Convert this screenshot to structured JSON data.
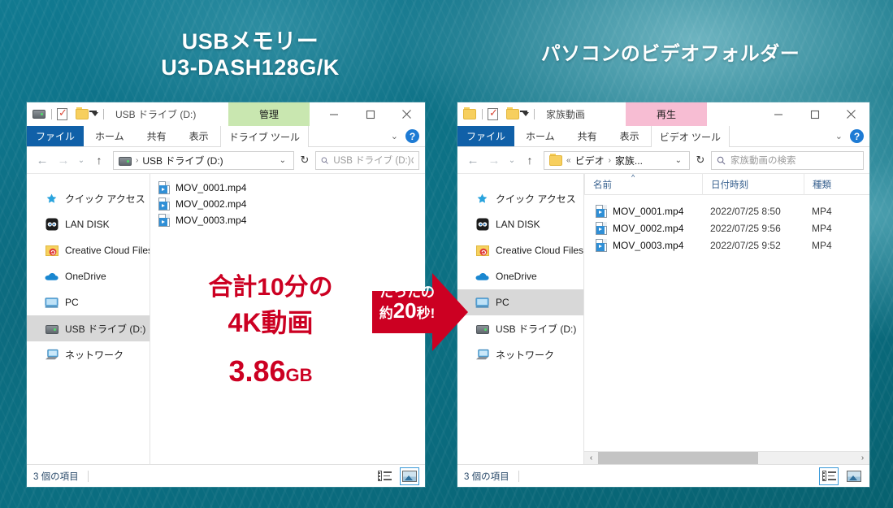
{
  "headings": {
    "left": "USBメモリー\nU3-DASH128G/K",
    "left_line1": "USBメモリー",
    "left_line2": "U3-DASH128G/K",
    "right": "パソコンのビデオフォルダー"
  },
  "colors": {
    "background_teal": "#0c7184",
    "accent_red": "#cc0022",
    "arrow_red": "#cc0022",
    "file_tab_blue": "#1060a8",
    "manage_tab_green": "#c9e7b0",
    "play_tab_pink": "#f7bdd3",
    "selection_gray": "#d8d8d8",
    "status_text_blue": "#2a4a6a"
  },
  "annotation": {
    "transfer_line1": "合計10分の",
    "transfer_line2": "4K動画",
    "transfer_size_value": "3.86",
    "transfer_size_unit": "GB",
    "arrow_line1": "たったの",
    "arrow_line2_prefix": "約",
    "arrow_line2_number": "20",
    "arrow_line2_suffix": "秒!"
  },
  "window_left": {
    "titlebar": {
      "title": "USB ドライブ (D:)",
      "qat_icons": [
        "drive-icon",
        "properties-icon",
        "new-folder-icon",
        "customize-caret-icon"
      ],
      "context_tab_label": "管理",
      "context_tab_color": "#c9e7b0",
      "minimize": "—",
      "maximize": "□",
      "close": "✕"
    },
    "ribbon": {
      "file_tab": "ファイル",
      "tabs": [
        "ホーム",
        "共有",
        "表示"
      ],
      "context_tab": "ドライブ ツール",
      "chevron": "⌄",
      "help": "?"
    },
    "navbar": {
      "back": "←",
      "forward": "→",
      "recent": "⌄",
      "up": "↑",
      "breadcrumb": [
        "USB ドライブ (D:)"
      ],
      "breadcrumb_icon": "drive-icon",
      "address_dropdown": "⌄",
      "refresh": "↻",
      "search_placeholder": "USB ドライブ (D:)の..."
    },
    "sidebar": {
      "items": [
        {
          "label": "クイック アクセス",
          "icon": "star-icon",
          "selected": false
        },
        {
          "label": "LAN DISK",
          "icon": "nas-icon",
          "selected": false
        },
        {
          "label": "Creative Cloud Files",
          "icon": "creative-cloud-icon",
          "selected": false
        },
        {
          "label": "OneDrive",
          "icon": "cloud-icon",
          "selected": false
        },
        {
          "label": "PC",
          "icon": "monitor-icon",
          "selected": false
        },
        {
          "label": "USB ドライブ (D:)",
          "icon": "drive-icon",
          "selected": true
        },
        {
          "label": "ネットワーク",
          "icon": "network-icon",
          "selected": false
        }
      ]
    },
    "files": [
      {
        "name": "MOV_0001.mp4",
        "icon": "mp4-file-icon"
      },
      {
        "name": "MOV_0002.mp4",
        "icon": "mp4-file-icon"
      },
      {
        "name": "MOV_0003.mp4",
        "icon": "mp4-file-icon"
      }
    ],
    "statusbar": {
      "count_text": "3 個の項目",
      "view_details": "details-view-icon",
      "view_thumbnails": "thumbnail-view-icon",
      "active_view": "thumbnails"
    }
  },
  "window_right": {
    "titlebar": {
      "title": "家族動画",
      "qat_icons": [
        "folder-icon",
        "properties-icon",
        "new-folder-icon",
        "customize-caret-icon"
      ],
      "context_tab_label": "再生",
      "context_tab_color": "#f7bdd3",
      "minimize": "—",
      "maximize": "□",
      "close": "✕"
    },
    "ribbon": {
      "file_tab": "ファイル",
      "tabs": [
        "ホーム",
        "共有",
        "表示"
      ],
      "context_tab": "ビデオ ツール",
      "chevron": "⌄",
      "help": "?"
    },
    "navbar": {
      "back": "←",
      "forward": "→",
      "recent": "⌄",
      "up": "↑",
      "breadcrumb": [
        "ビデオ",
        "家族..."
      ],
      "breadcrumb_prefix": "«",
      "breadcrumb_icon": "folder-icon",
      "address_dropdown": "⌄",
      "refresh": "↻",
      "search_placeholder": "家族動画の検索"
    },
    "sidebar": {
      "items": [
        {
          "label": "クイック アクセス",
          "icon": "star-icon",
          "selected": false
        },
        {
          "label": "LAN DISK",
          "icon": "nas-icon",
          "selected": false
        },
        {
          "label": "Creative Cloud Files",
          "icon": "creative-cloud-icon",
          "selected": false
        },
        {
          "label": "OneDrive",
          "icon": "cloud-icon",
          "selected": false
        },
        {
          "label": "PC",
          "icon": "monitor-icon",
          "selected": true
        },
        {
          "label": "USB ドライブ (D:)",
          "icon": "drive-icon",
          "selected": false
        },
        {
          "label": "ネットワーク",
          "icon": "network-icon",
          "selected": false
        }
      ]
    },
    "columns": [
      "名前",
      "日付時刻",
      "種類"
    ],
    "sort_indicator": "^",
    "files": [
      {
        "name": "MOV_0001.mp4",
        "date": "2022/07/25 8:50",
        "type": "MP4",
        "icon": "mp4-file-icon"
      },
      {
        "name": "MOV_0002.mp4",
        "date": "2022/07/25 9:56",
        "type": "MP4",
        "icon": "mp4-file-icon"
      },
      {
        "name": "MOV_0003.mp4",
        "date": "2022/07/25 9:52",
        "type": "MP4",
        "icon": "mp4-file-icon"
      }
    ],
    "scrollbar": {
      "left_arrow": "‹",
      "right_arrow": "›"
    },
    "statusbar": {
      "count_text": "3 個の項目",
      "view_details": "details-view-icon",
      "view_thumbnails": "thumbnail-view-icon",
      "active_view": "details"
    }
  }
}
